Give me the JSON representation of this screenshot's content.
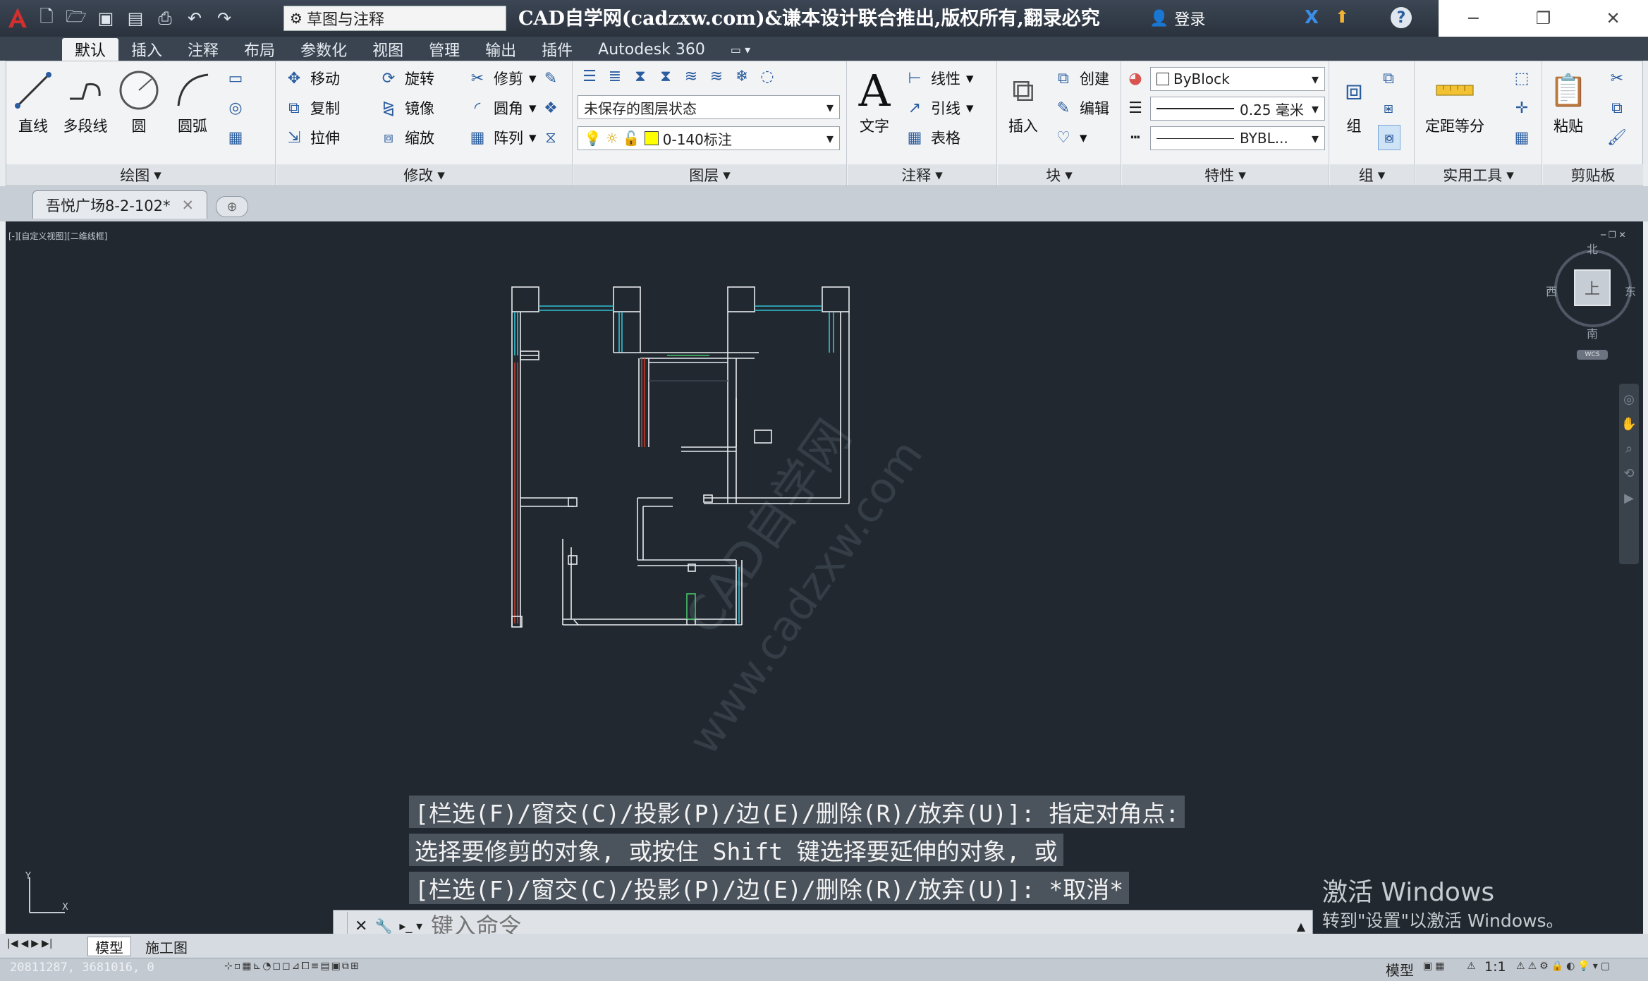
{
  "title_bar": {
    "title": "CAD自学网(cadzxw.com)&谦本设计联合推出,版权所有,翻录必究",
    "workspace": "草图与注释",
    "login": "登录"
  },
  "ribbon_tabs": [
    "默认",
    "插入",
    "注释",
    "布局",
    "参数化",
    "视图",
    "管理",
    "输出",
    "插件",
    "Autodesk 360"
  ],
  "panels": {
    "draw": {
      "label": "绘图",
      "line": "直线",
      "polyline": "多段线",
      "circle": "圆",
      "arc": "圆弧"
    },
    "modify": {
      "label": "修改",
      "move": "移动",
      "rotate": "旋转",
      "trim": "修剪",
      "copy": "复制",
      "mirror": "镜像",
      "fillet": "圆角",
      "stretch": "拉伸",
      "scale": "缩放",
      "array": "阵列"
    },
    "layers": {
      "label": "图层",
      "state": "未保存的图层状态",
      "current": "0-140标注"
    },
    "annotation": {
      "label": "注释",
      "text": "文字",
      "dimension": "线性",
      "leader": "引线",
      "table": "表格"
    },
    "block": {
      "label": "块",
      "insert": "插入",
      "create": "创建",
      "edit": "编辑"
    },
    "properties": {
      "label": "特性",
      "color": "ByBlock",
      "lineweight": "0.25 毫米",
      "linetype": "BYBL..."
    },
    "groups": {
      "label": "组",
      "group": "组"
    },
    "utilities": {
      "label": "实用工具",
      "measure": "定距等分"
    },
    "clipboard": {
      "label": "剪贴板",
      "paste": "粘贴"
    }
  },
  "file_tab": "吾悦广场8-2-102*",
  "viewport": {
    "label": "[-][自定义视图][二维线框]",
    "compass": {
      "north": "北",
      "south": "南",
      "east": "东",
      "west": "西",
      "top": "上",
      "wcs": "WCS"
    },
    "watermark": "www.cadzxw.com",
    "watermark_cn": "CAD自学网"
  },
  "command_history": [
    "[栏选(F)/窗交(C)/投影(P)/边(E)/删除(R)/放弃(U)]: 指定对角点:",
    "选择要修剪的对象, 或按住 Shift 键选择要延伸的对象, 或",
    "[栏选(F)/窗交(C)/投影(P)/边(E)/删除(R)/放弃(U)]: *取消*"
  ],
  "command_input": {
    "placeholder": "键入命令"
  },
  "activation": {
    "line1": "激活 Windows",
    "line2": "转到\"设置\"以激活 Windows。"
  },
  "layout_tabs": [
    "模型",
    "施工图"
  ],
  "status_bar": {
    "coords": "20811287,  3681016,  0",
    "model": "模型",
    "scale": "1:1"
  },
  "colors": {
    "canvas": "#212830",
    "accent": "#2a5d9f",
    "wall": "#e8ecef",
    "wall_red": "#c0392b",
    "wall_cyan": "#2ec4d6"
  }
}
